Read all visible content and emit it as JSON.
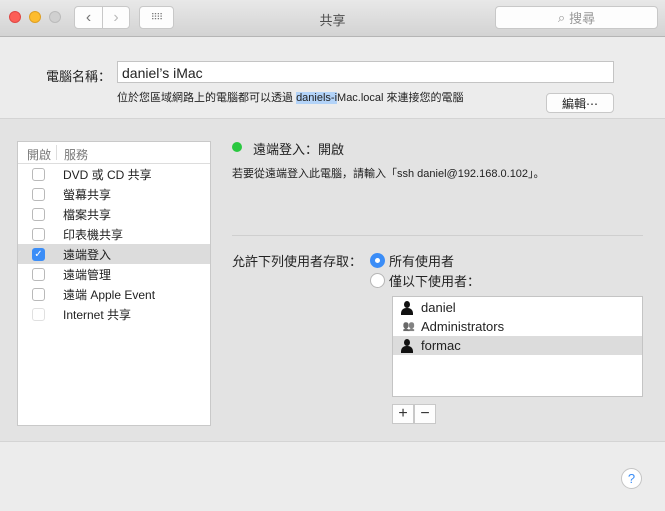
{
  "window": {
    "title": "共享",
    "search_placeholder": "搜尋"
  },
  "computer_name": {
    "label": "電腦名稱：",
    "value": "daniel’s iMac",
    "desc_prefix": "位於您區域網路上的電腦都可以透過 ",
    "desc_host_selected": "daniels-i",
    "desc_host_rest": "Mac.local",
    "desc_suffix": " 來連接您的電腦",
    "edit_button": "編輯⋯"
  },
  "services": {
    "header_on": "開啟",
    "header_service": "服務",
    "items": [
      {
        "label": "DVD 或 CD 共享",
        "checked": false
      },
      {
        "label": "螢幕共享",
        "checked": false
      },
      {
        "label": "檔案共享",
        "checked": false
      },
      {
        "label": "印表機共享",
        "checked": false
      },
      {
        "label": "遠端登入",
        "checked": true,
        "selected": true
      },
      {
        "label": "遠端管理",
        "checked": false
      },
      {
        "label": "遠端 Apple Event",
        "checked": false
      },
      {
        "label": "Internet 共享",
        "checked": false,
        "disabled": true
      }
    ]
  },
  "detail": {
    "status": "遠端登入：開啟",
    "status_color": "#2ac840",
    "description": "若要從遠端登入此電腦，請輸入「ssh daniel@192.168.0.102」。",
    "access_label": "允許下列使用者存取：",
    "option_all": "所有使用者",
    "option_only": "僅以下使用者：",
    "selected_option": "all",
    "users": [
      {
        "name": "daniel",
        "icon": "user-icon"
      },
      {
        "name": "Administrators",
        "icon": "group-icon"
      },
      {
        "name": "formac",
        "icon": "user-icon",
        "selected": true
      }
    ],
    "add": "+",
    "remove": "−"
  },
  "help": "?"
}
